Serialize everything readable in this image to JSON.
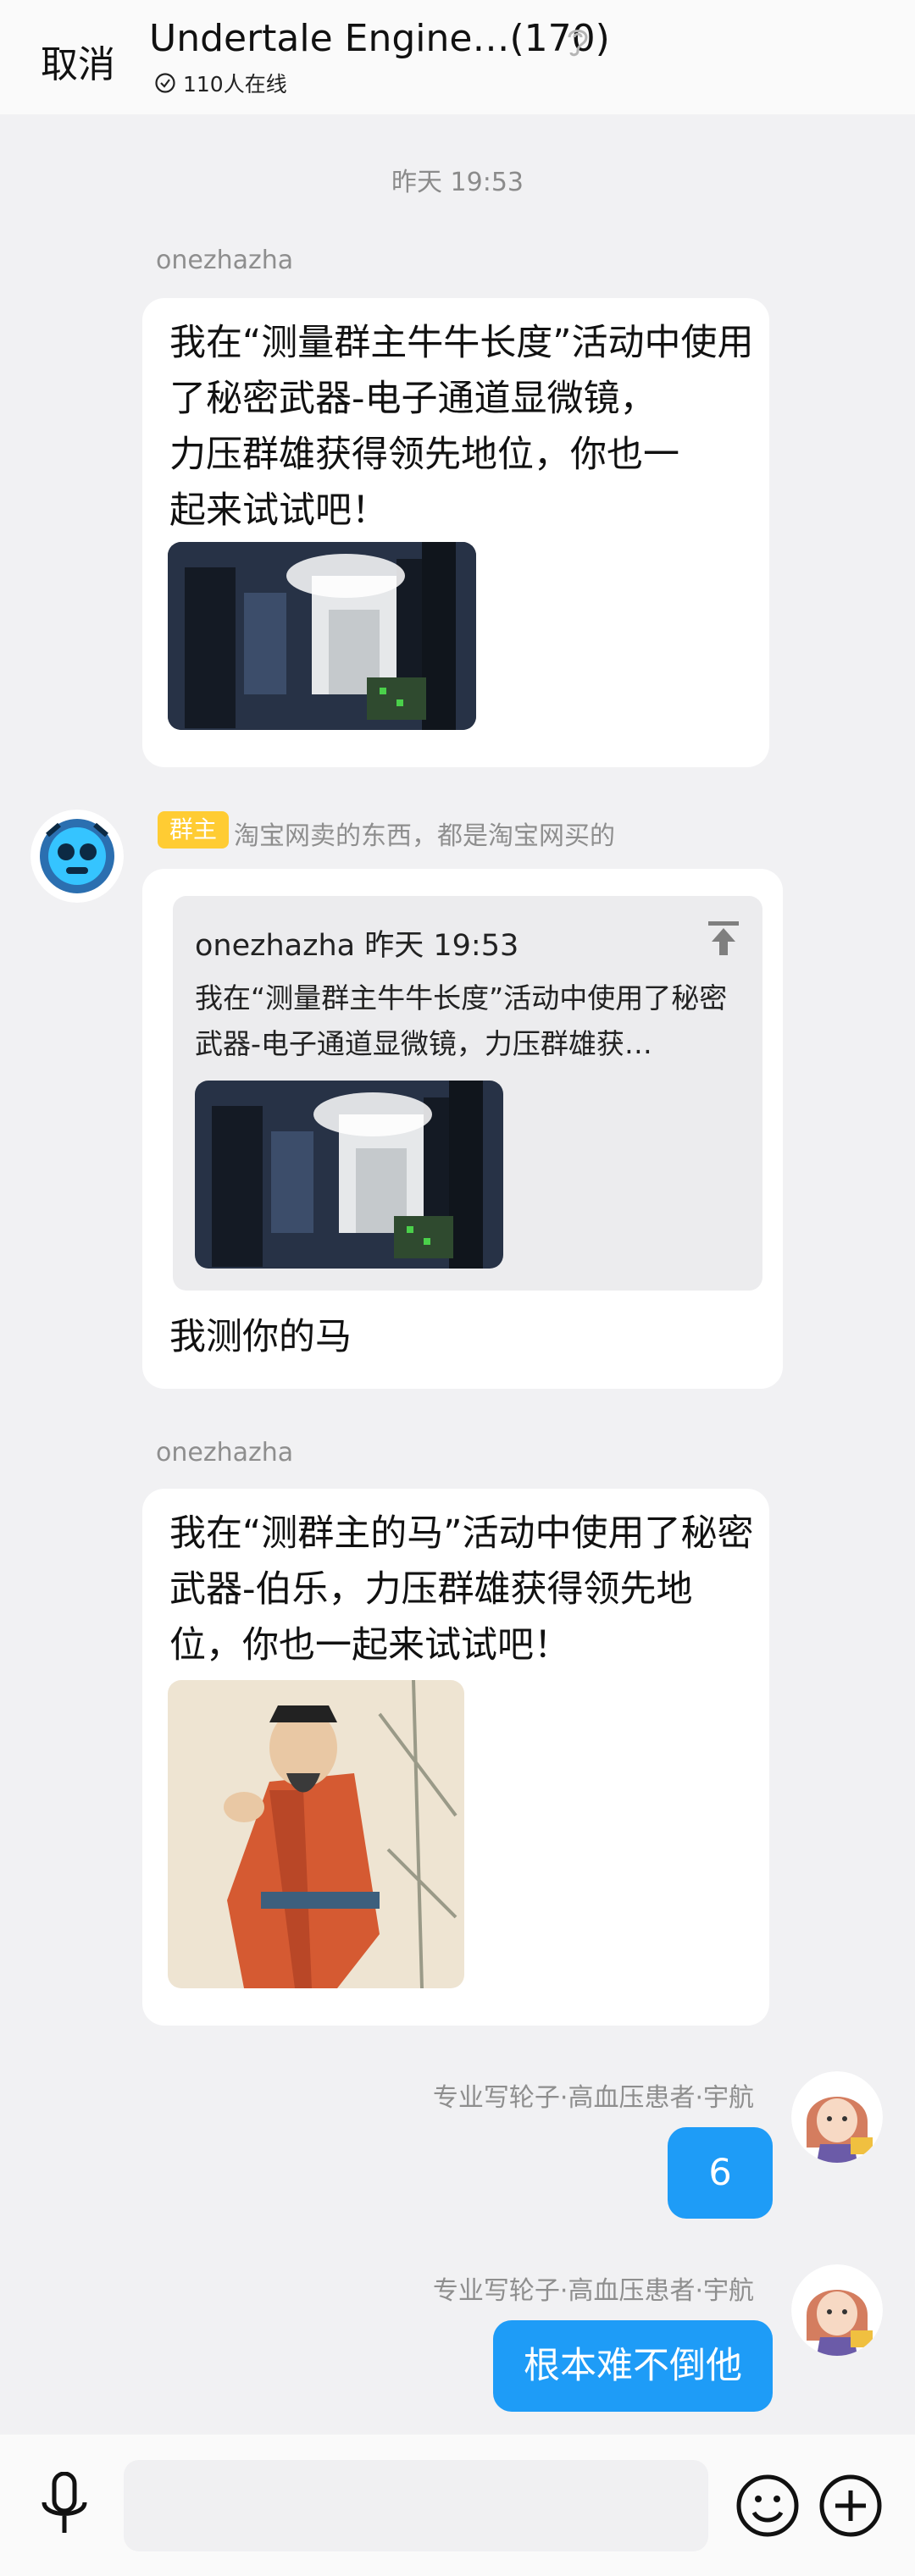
{
  "header": {
    "cancel_label": "取消",
    "title": "Undertale Engine…(170)",
    "online_text": "110人在线"
  },
  "chat": {
    "timestamp": "昨天 19:53",
    "messages": [
      {
        "sender": "onezhazha",
        "text_lines": [
          "我在“测量群主牛牛长度”活动中使用了秘密武器-电子通道显微镜，",
          "力压群雄获得领先地位，你也一",
          "起来试试吧！"
        ]
      },
      {
        "sender": "淘宝网卖的东西，都是淘宝网买的",
        "badge": "群主",
        "quote": {
          "header": "onezhazha 昨天 19:53",
          "text": "我在“测量群主牛牛长度”活动中使用了秘密武器-电子通道显微镜，力压群雄获…"
        },
        "reply": "我测你的马"
      },
      {
        "sender": "onezhazha",
        "text": "我在“测群主的马”活动中使用了秘密武器-伯乐，力压群雄获得领先地位，你也一起来试试吧！"
      },
      {
        "sender": "专业写轮子·高血压患者·宇航",
        "text": "6"
      },
      {
        "sender": "专业写轮子·高血压患者·宇航",
        "text": "根本难不倒他"
      }
    ]
  },
  "composer": {
    "input_value": ""
  },
  "colors": {
    "accent": "#1e9cf7",
    "badge": "#ffcc33",
    "background": "#f1f1f3"
  },
  "icons": [
    "ear-icon",
    "check-circle-icon",
    "pin-top-icon",
    "microphone-icon",
    "emoji-icon",
    "plus-circle-icon"
  ]
}
